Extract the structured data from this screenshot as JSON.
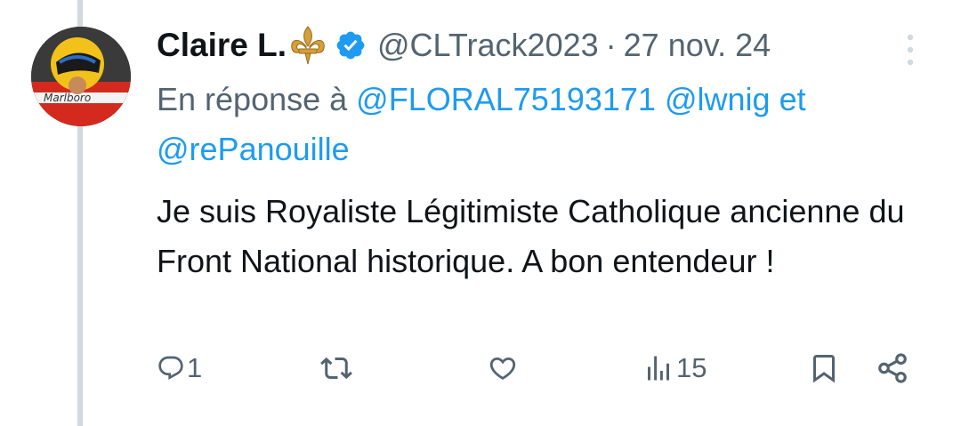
{
  "author": {
    "name": "Claire L.",
    "handle": "@CLTrack2023",
    "separator": "·",
    "date": "27 nov. 24",
    "emoji_icon": "fleur-de-lis-icon",
    "verified_icon": "verified-badge-icon"
  },
  "reply": {
    "prefix": "En réponse à",
    "mention_1": "@FLORAL75193171",
    "mention_2": "@lwnig",
    "conjunction": "et",
    "mention_3": "@rePanouille"
  },
  "tweet": {
    "text": "Je suis Royaliste Légitimiste Catholique ancienne du Front National historique. A bon entendeur !"
  },
  "actions": {
    "reply_count": "1",
    "retweet_count": "",
    "like_count": "",
    "views_count": "15"
  },
  "colors": {
    "accent": "#1d9bf0",
    "secondary_text": "#536471",
    "primary_text": "#0f1419",
    "thread_line": "#cfd9de",
    "fleur_gold": "#d4a037"
  }
}
